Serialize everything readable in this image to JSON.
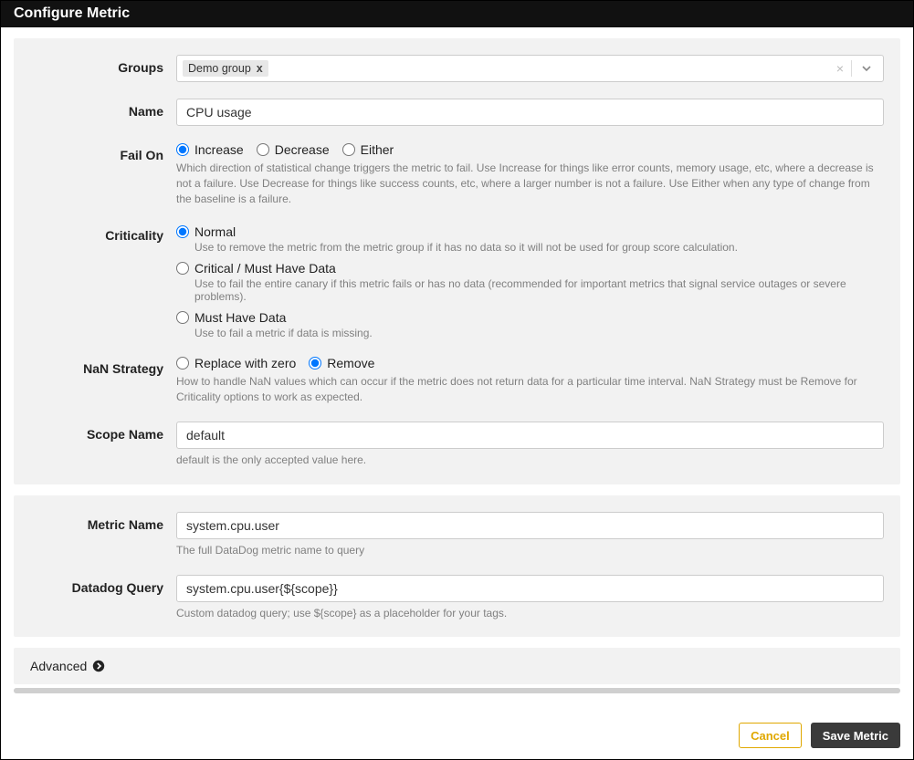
{
  "header": {
    "title": "Configure Metric"
  },
  "labels": {
    "groups": "Groups",
    "name": "Name",
    "failOn": "Fail On",
    "criticality": "Criticality",
    "nan": "NaN Strategy",
    "scopeName": "Scope Name",
    "metricName": "Metric Name",
    "datadogQuery": "Datadog Query",
    "advanced": "Advanced"
  },
  "groups": {
    "selected": "Demo group",
    "selectedRemove": "x",
    "clear": "×"
  },
  "name": {
    "value": "CPU usage"
  },
  "failOn": {
    "options": {
      "increase": "Increase",
      "decrease": "Decrease",
      "either": "Either"
    },
    "selected": "increase",
    "help": "Which direction of statistical change triggers the metric to fail. Use Increase for things like error counts, memory usage, etc, where a decrease is not a failure. Use Decrease for things like success counts, etc, where a larger number is not a failure. Use Either when any type of change from the baseline is a failure."
  },
  "criticality": {
    "options": {
      "normal": {
        "label": "Normal",
        "help": "Use to remove the metric from the metric group if it has no data so it will not be used for group score calculation."
      },
      "critical": {
        "label": "Critical / Must Have Data",
        "help": "Use to fail the entire canary if this metric fails or has no data (recommended for important metrics that signal service outages or severe problems)."
      },
      "mustHave": {
        "label": "Must Have Data",
        "help": "Use to fail a metric if data is missing."
      }
    },
    "selected": "normal"
  },
  "nan": {
    "options": {
      "replace": "Replace with zero",
      "remove": "Remove"
    },
    "selected": "remove",
    "help": "How to handle NaN values which can occur if the metric does not return data for a particular time interval. NaN Strategy must be Remove for Criticality options to work as expected."
  },
  "scopeName": {
    "value": "default",
    "help": "default is the only accepted value here."
  },
  "metricName": {
    "value": "system.cpu.user",
    "help": "The full DataDog metric name to query"
  },
  "datadogQuery": {
    "value": "system.cpu.user{${scope}}",
    "help": "Custom datadog query; use ${scope} as a placeholder for your tags."
  },
  "footer": {
    "cancel": "Cancel",
    "save": "Save Metric"
  }
}
